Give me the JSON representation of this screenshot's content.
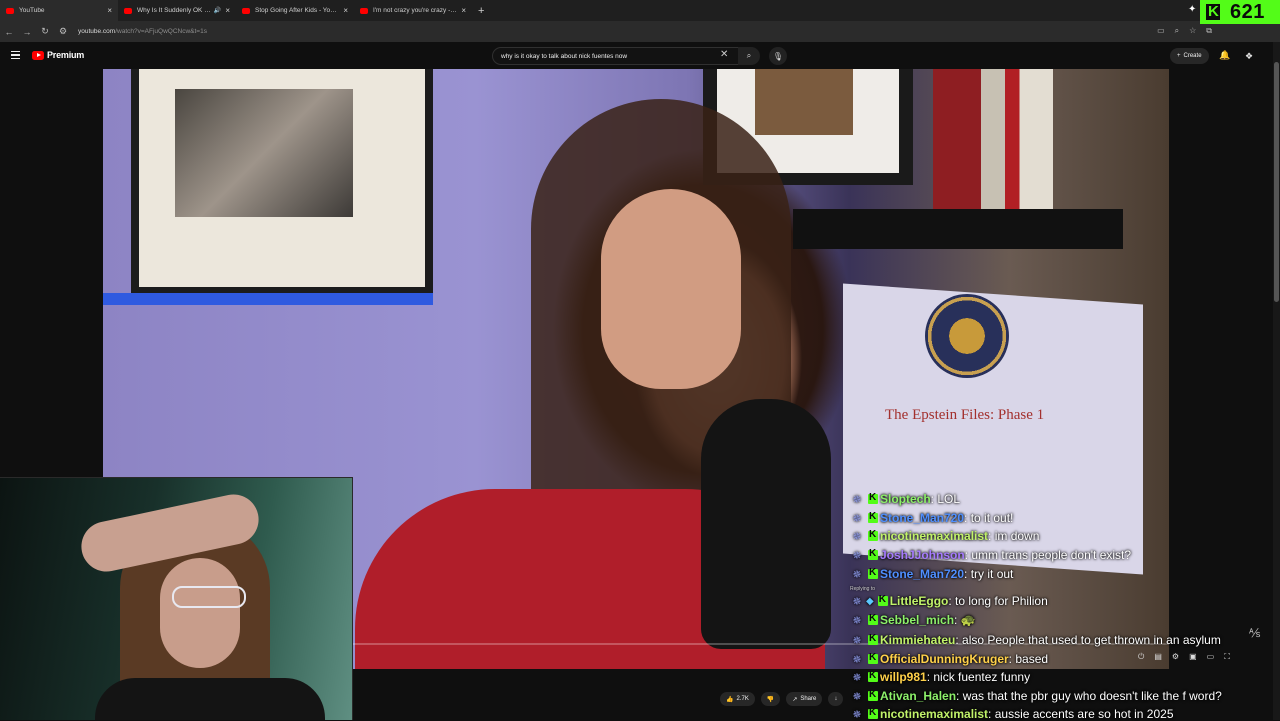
{
  "browser": {
    "tabs": [
      {
        "title": "YouTube",
        "active": true
      },
      {
        "title": "Why Is It Suddenly OK to Talk",
        "active": false,
        "audio": true
      },
      {
        "title": "Stop Going After Kids - YouTube",
        "active": false
      },
      {
        "title": "I'm not crazy you're crazy - YouT",
        "active": false
      }
    ],
    "url_host": "youtube.com",
    "url_path": "/watch?v=AFjuQwQCNcw&t=1s"
  },
  "overlay": {
    "follower_count": "621",
    "colors": {
      "accent": "#53fc18"
    }
  },
  "youtube": {
    "logo_label": "Premium",
    "search": {
      "value": "why is it okay to talk about nick fuentes now"
    },
    "create_label": "Create",
    "video": {
      "poster_text": "The Epstein Files: Phase 1"
    },
    "actions": {
      "like_count": "2.7K",
      "share_label": "Share"
    }
  },
  "chat": {
    "messages": [
      {
        "user": "Sloptech",
        "color": "#8df06a",
        "text": ": LOL"
      },
      {
        "user": "Stone_Man720",
        "color": "#4f8fff",
        "text": ": to it out!"
      },
      {
        "user": "nicotinemaximalist",
        "color": "#c1f26a",
        "text": ": im down"
      },
      {
        "user": "JoshJJohnson",
        "color": "#a67bff",
        "text": ": umm trans people don't exist?"
      },
      {
        "user": "Stone_Man720",
        "color": "#4f8fff",
        "text": ": try it out"
      },
      {
        "user": "LittleEggo",
        "color": "#c1f26a",
        "text": ": to long for Philion",
        "gem": true,
        "reply": "Replying to"
      },
      {
        "user": "Sebbel_mich",
        "color": "#8df06a",
        "text": ": 🐢"
      },
      {
        "user": "Kimmiehateu",
        "color": "#c1f26a",
        "text": ": also People that used to get thrown in an asylum"
      },
      {
        "user": "OfficialDunningKruger",
        "color": "#ffd14a",
        "text": ": based"
      },
      {
        "user": "willp981",
        "color": "#ffd14a",
        "text": ": nick fuentez funny"
      },
      {
        "user": "Ativan_Halen",
        "color": "#8df06a",
        "text": ": was that the pbr guy who doesn't like the f word?"
      },
      {
        "user": "nicotinemaximalist",
        "color": "#c1f26a",
        "text": ": aussie accents are so hot in 2025"
      }
    ]
  }
}
